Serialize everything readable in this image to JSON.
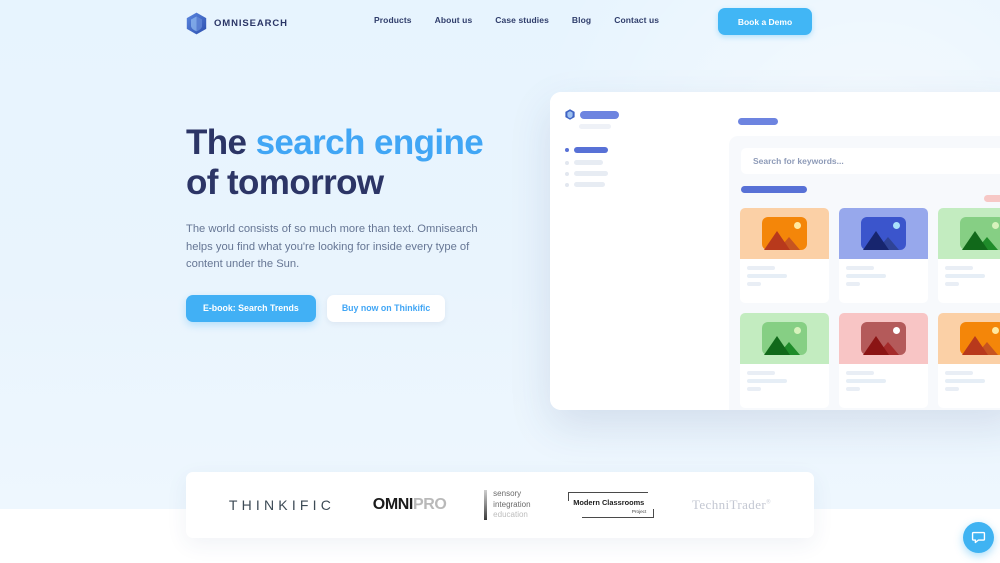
{
  "theme": {
    "page_bg": "#e7f4fe",
    "accent_blue": "#41b0f5",
    "title_navy": "#2c3566",
    "title_accent": "#41a6f5",
    "body_text": "#667694",
    "mock_indigo": "#5871d6"
  },
  "header": {
    "brand_name": "OMNISEARCH",
    "brand_icon": "hexagon-shield-icon",
    "nav": [
      {
        "label": "Products"
      },
      {
        "label": "About us"
      },
      {
        "label": "Case studies"
      },
      {
        "label": "Blog"
      },
      {
        "label": "Contact us"
      }
    ],
    "demo_button": "Book a Demo"
  },
  "hero": {
    "title_part1": "The ",
    "title_accent": "search engine",
    "title_part2": "of tomorrow",
    "subtitle": "The world consists of so much more than text. Omnisearch helps you find what you're looking for inside every type of content under the Sun.",
    "cta_primary": "E-book: Search Trends",
    "cta_secondary": "Buy now on Thinkific"
  },
  "mockup": {
    "search_placeholder": "Search for keywords...",
    "sidebar_logo_icon": "hexagon-shield-icon",
    "sidebar_nav_rows": 4,
    "cards": [
      {
        "bg": "#fbd0a6",
        "thumb": "#f48609",
        "mountain_far": "#b8391c",
        "mountain_near": "#c75420",
        "sun": "#ffe9a1"
      },
      {
        "bg": "#97a8ec",
        "thumb": "#3b55cc",
        "mountain_far": "#17256e",
        "mountain_near": "#2f4396",
        "sun": "#a9e1fb"
      },
      {
        "bg": "#c3ecc0",
        "thumb": "#86cf84",
        "mountain_far": "#11691a",
        "mountain_near": "#1f8c2a",
        "sun": "#d7f3bc"
      },
      {
        "bg": "#f8c5c5",
        "thumb": "#b45a5a",
        "mountain_far": "#8b1414",
        "mountain_near": "#a52b2b",
        "sun": "#ffffff"
      },
      {
        "bg": "#c3ecc0",
        "thumb": "#86cf84",
        "mountain_far": "#11691a",
        "mountain_near": "#1f8c2a",
        "sun": "#d7f3bc"
      },
      {
        "bg": "#f8c5c5",
        "thumb": "#b45a5a",
        "mountain_far": "#8b1414",
        "mountain_near": "#a52b2b",
        "sun": "#ffffff"
      },
      {
        "bg": "#fbd0a6",
        "thumb": "#f48609",
        "mountain_far": "#b8391c",
        "mountain_near": "#c75420",
        "sun": "#ffe9a1"
      },
      {
        "bg": "#97a8ec",
        "thumb": "#3b55cc",
        "mountain_far": "#17256e",
        "mountain_near": "#2f4396",
        "sun": "#a9e1fb"
      }
    ]
  },
  "logos": {
    "thinkific": "THINKIFIC",
    "omnipro_bold": "OMNI",
    "omnipro_light": "PRO",
    "sensory_line1": "sensory",
    "sensory_line2": "integration",
    "sensory_line3": "education",
    "mcp_main": "Modern Classrooms",
    "mcp_sub": "Project",
    "technitrader": "TechniTrader",
    "technitrader_sup": "®"
  },
  "chat": {
    "icon": "chat-bubble-icon",
    "label": "Open chat"
  }
}
